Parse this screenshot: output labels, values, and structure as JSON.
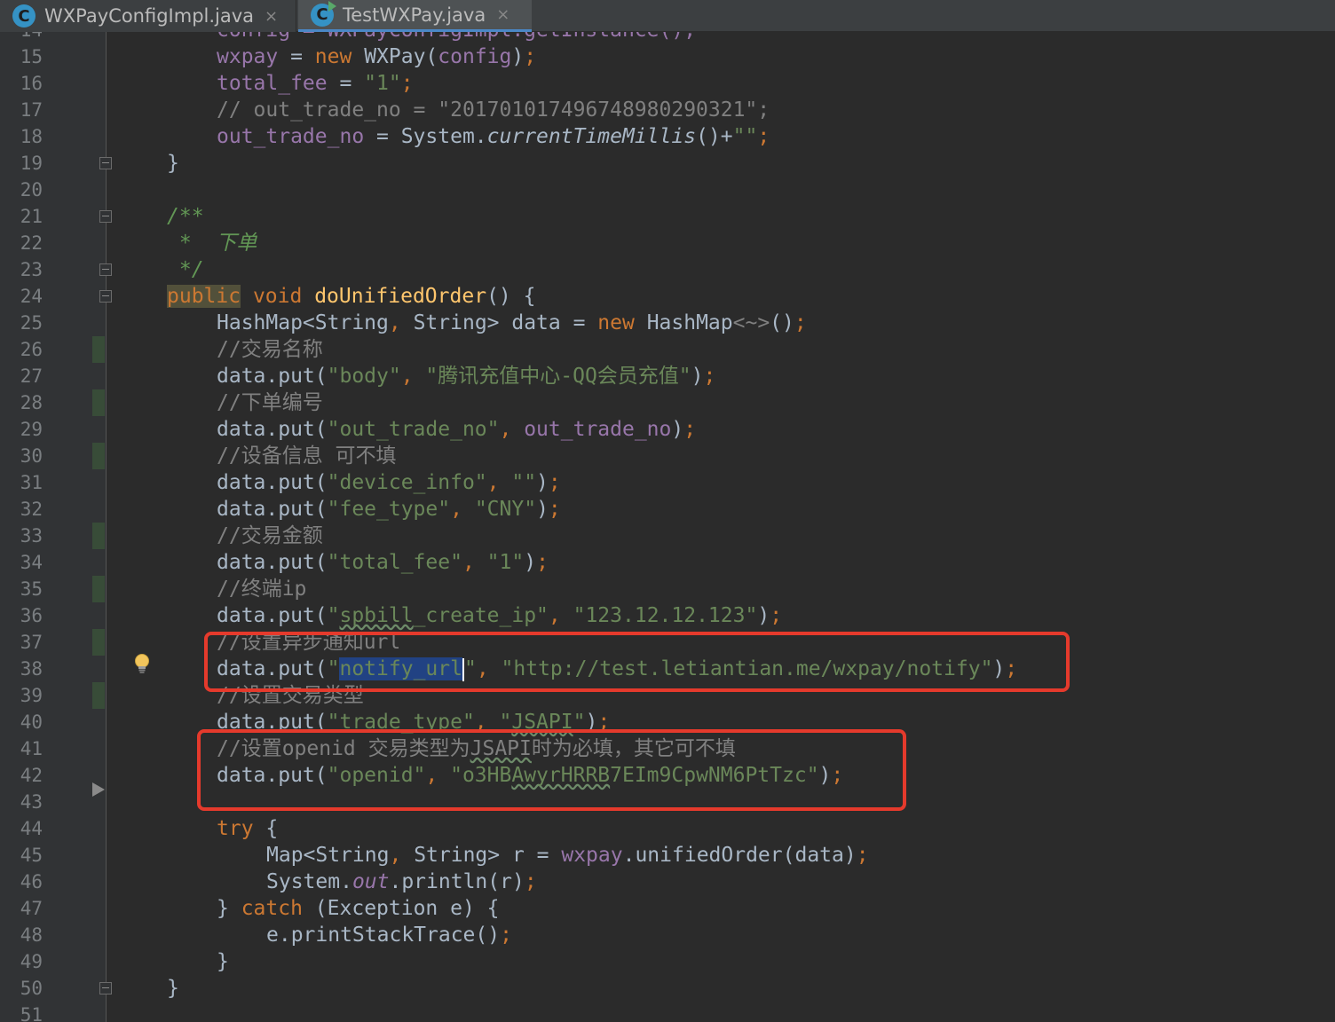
{
  "tabs": [
    {
      "icon": "class-icon",
      "label": "WXPayConfigImpl.java",
      "close": "×"
    },
    {
      "icon": "class-icon-run",
      "label": "TestWXPay.java",
      "close": "×"
    }
  ],
  "lines": [
    {
      "n": "14",
      "partial": "config = WXPayConfigImpl.getInstance();"
    },
    {
      "n": "15",
      "wxpay": "wxpay",
      "eq": " = ",
      "new": "new",
      "rest1": " WXPay(",
      "config": "config",
      "rest2": ")",
      "semi": ";"
    },
    {
      "n": "16",
      "fld": "total_fee",
      "eq": " = ",
      "str": "\"1\"",
      "semi": ";"
    },
    {
      "n": "17",
      "cmt": "// out_trade_no = \"201701017496748980290321\";"
    },
    {
      "n": "18",
      "fld": "out_trade_no",
      "eq": " = System.",
      "mth": "currentTimeMillis",
      "rest": "()+",
      "str": "\"\"",
      "semi": ";"
    },
    {
      "n": "19",
      "text": "}"
    },
    {
      "n": "20"
    },
    {
      "n": "21",
      "doc": "/**"
    },
    {
      "n": "22",
      "doc": " *  下单"
    },
    {
      "n": "23",
      "doc": " */"
    },
    {
      "n": "24",
      "kw1": "public",
      "kw2": " void ",
      "mth": "doUnifiedOrder",
      "rest": "() {"
    },
    {
      "n": "25",
      "a": "HashMap<String",
      "b": ", ",
      "c": "String> data = ",
      "new": "new",
      "d": " HashMap",
      "diamond": "<~>",
      "e": "()",
      "semi": ";"
    },
    {
      "n": "26",
      "cmt": "//交易名称"
    },
    {
      "n": "27",
      "pre": "data.put(",
      "s1": "\"body\"",
      "sep": ", ",
      "s2": "\"腾讯充值中心-QQ会员充值\"",
      "post": ")",
      "semi": ";"
    },
    {
      "n": "28",
      "cmt": "//下单编号"
    },
    {
      "n": "29",
      "pre": "data.put(",
      "s1": "\"out_trade_no\"",
      "sep": ", ",
      "fld": "out_trade_no",
      "post": ")",
      "semi": ";"
    },
    {
      "n": "30",
      "cmt": "//设备信息 可不填"
    },
    {
      "n": "31",
      "pre": "data.put(",
      "s1": "\"device_info\"",
      "sep": ", ",
      "s2": "\"\"",
      "post": ")",
      "semi": ";"
    },
    {
      "n": "32",
      "pre": "data.put(",
      "s1": "\"fee_type\"",
      "sep": ", ",
      "s2": "\"CNY\"",
      "post": ")",
      "semi": ";"
    },
    {
      "n": "33",
      "cmt": "//交易金额"
    },
    {
      "n": "34",
      "pre": "data.put(",
      "s1": "\"total_fee\"",
      "sep": ", ",
      "s2": "\"1\"",
      "post": ")",
      "semi": ";"
    },
    {
      "n": "35",
      "cmt": "//终端ip"
    },
    {
      "n": "36",
      "pre": "data.put(",
      "q1": "\"",
      "wv": "spbill",
      "s1rest": "_create_ip\"",
      "sep": ", ",
      "s2": "\"123.12.12.123\"",
      "post": ")",
      "semi": ";"
    },
    {
      "n": "37",
      "cmt": "//设置异步通知url"
    },
    {
      "n": "38",
      "pre": "data.put(",
      "q1": "\"",
      "sel": "notify_url",
      "q2": "\"",
      "sep": ", ",
      "s2": "\"http://test.letiantian.me/wxpay/notify\"",
      "post": ")",
      "semi": ";"
    },
    {
      "n": "39",
      "cmt": "//设置交易类型"
    },
    {
      "n": "40",
      "pre": "data.put(",
      "s1": "\"trade_type\"",
      "sep": ", ",
      "q1": "\"",
      "wv": "JSAPI",
      "q2": "\"",
      "post": ")",
      "semi": ";"
    },
    {
      "n": "41",
      "c1": "//设置openid 交易类型为",
      "wv": "JSAPI",
      "c2": "时为必填，其它可不填"
    },
    {
      "n": "42",
      "pre": "data.put(",
      "s1": "\"openid\"",
      "sep": ", ",
      "sa": "\"o3HB",
      "wv": "AwyrHRRB",
      "sb": "7EIm9CpwNM6PtTzc\"",
      "post": ")",
      "semi": ";"
    },
    {
      "n": "43"
    },
    {
      "n": "44",
      "kw": "try",
      "rest": " {"
    },
    {
      "n": "45",
      "a": "Map<String",
      "b": ", ",
      "c": "String> r = ",
      "fld": "wxpay",
      "d": ".unifiedOrder(data)",
      "semi": ";"
    },
    {
      "n": "46",
      "a": "System.",
      "fld": "out",
      "b": ".println(r)",
      "semi": ";"
    },
    {
      "n": "47",
      "a": "} ",
      "kw": "catch",
      "b": " (Exception e) {"
    },
    {
      "n": "48",
      "a": "e.printStackTrace()",
      "semi": ";"
    },
    {
      "n": "49",
      "text": "}"
    },
    {
      "n": "50",
      "text": "}"
    },
    {
      "n": "51"
    }
  ]
}
